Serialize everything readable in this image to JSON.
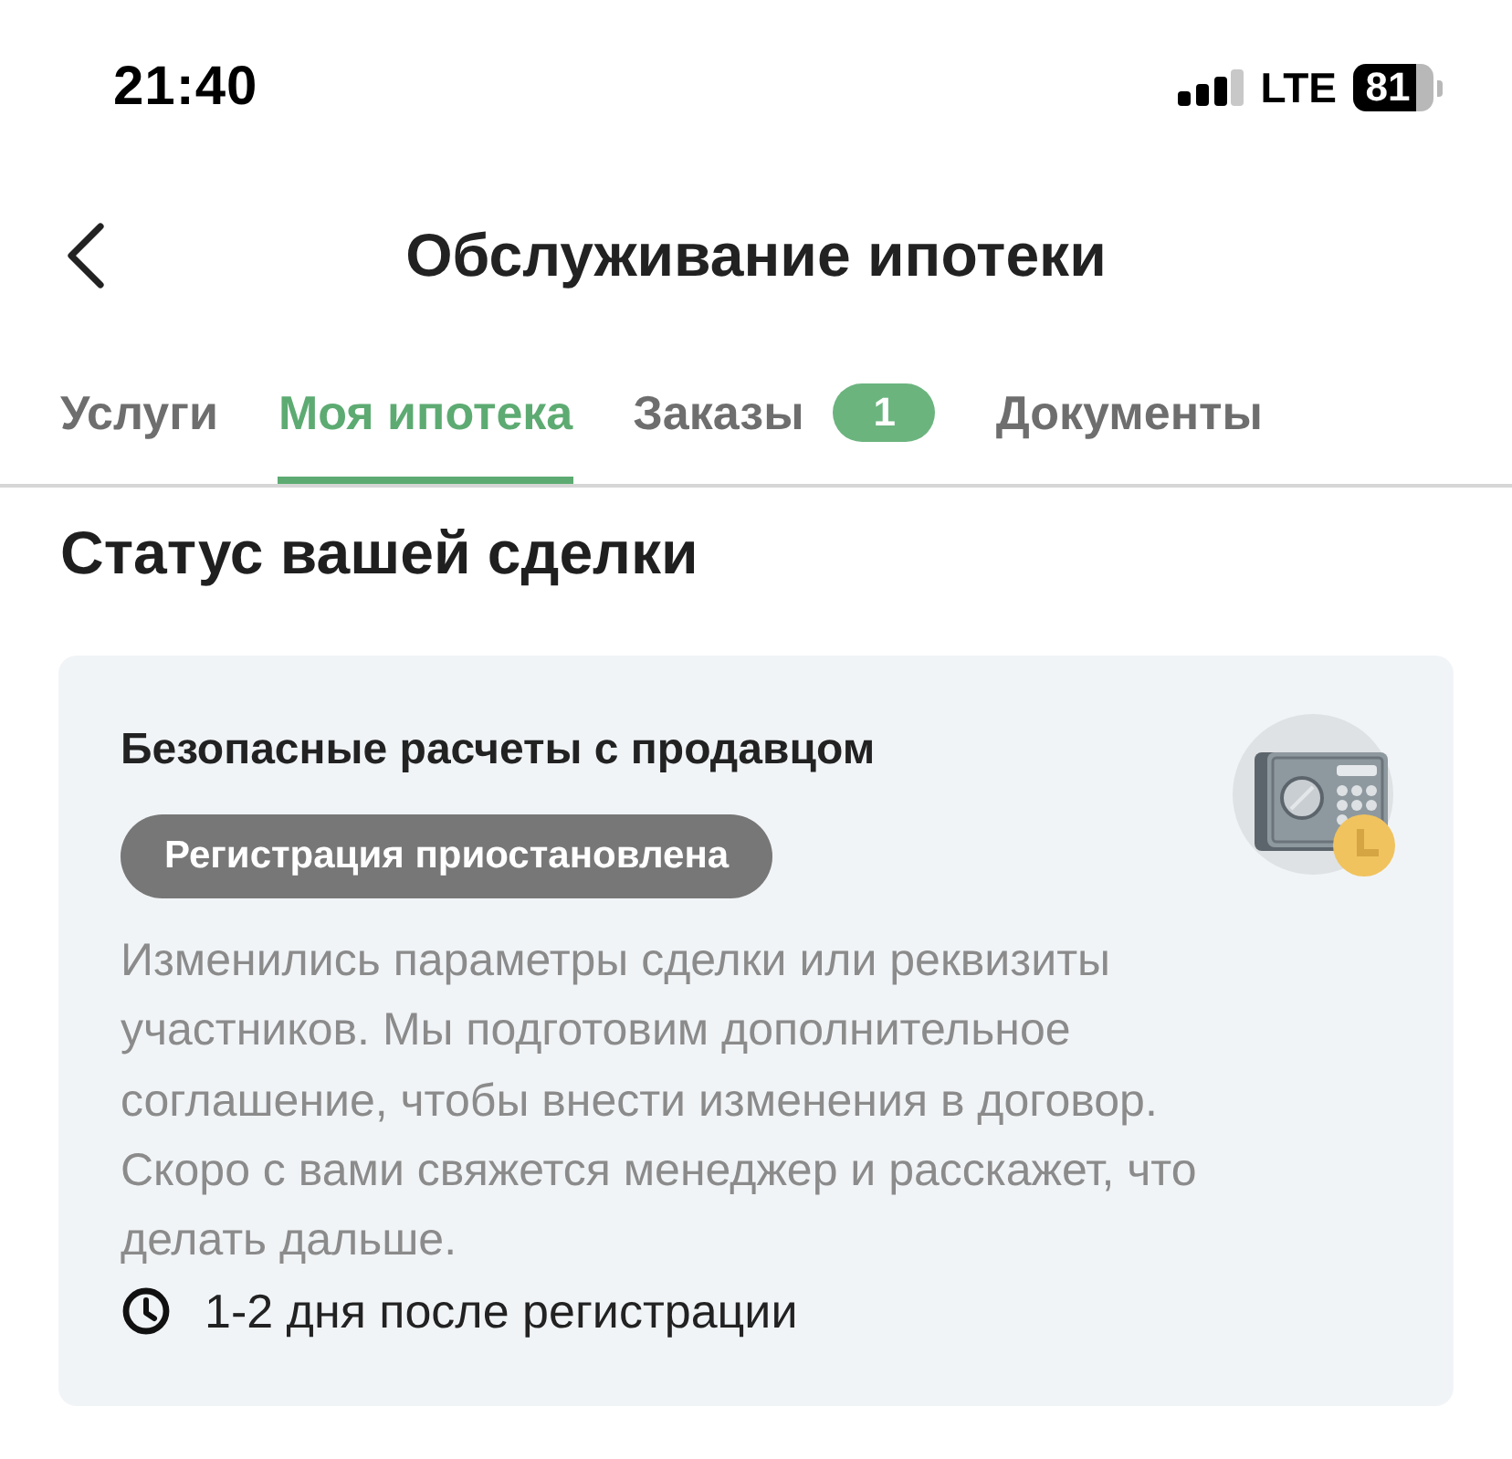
{
  "status_bar": {
    "time": "21:40",
    "network": "LTE",
    "battery": "81"
  },
  "header": {
    "title": "Обслуживание ипотеки"
  },
  "tabs": [
    {
      "label": "Услуги",
      "selected": false
    },
    {
      "label": "Моя ипотека",
      "selected": true
    },
    {
      "label": "Заказы",
      "selected": false,
      "badge": "1"
    },
    {
      "label": "Документы",
      "selected": false
    }
  ],
  "section": {
    "title": "Статус вашей сделки"
  },
  "card": {
    "title": "Безопасные расчеты с продавцом",
    "status": "Регистрация приостановлена",
    "description": "Изменились параметры сделки или реквизиты участников. Мы подготовим дополнительное соглашение, чтобы внести изменения в договор. Скоро с вами свяжется менеджер и расскажет, что делать дальше.",
    "timing": "1-2 дня после регистрации"
  }
}
